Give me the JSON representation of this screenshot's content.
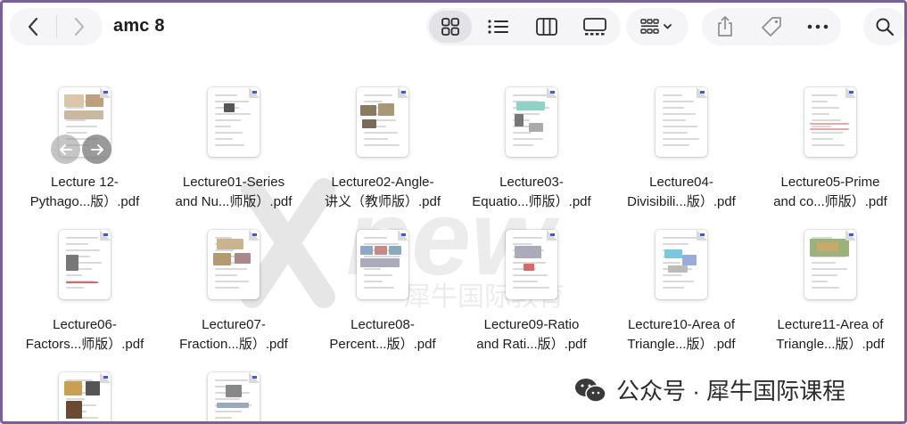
{
  "window": {
    "title": "amc 8"
  },
  "toolbar": {
    "back_icon": "chevron-left-icon",
    "forward_icon": "chevron-right-icon",
    "views": [
      "icon-view",
      "list-view",
      "column-view",
      "gallery-view"
    ],
    "active_view": "icon-view",
    "group_icon": "group-by-icon",
    "actions": [
      "share-icon",
      "tag-icon",
      "more-icon"
    ],
    "search_icon": "search-icon"
  },
  "files": [
    {
      "line1": "Lecture 12-",
      "line2": "Pythago...版）.pdf"
    },
    {
      "line1": "Lecture01-Series",
      "line2": "and Nu...师版）.pdf"
    },
    {
      "line1": "Lecture02-Angle-",
      "line2": "讲义（教师版）.pdf"
    },
    {
      "line1": "Lecture03-",
      "line2": "Equatio...师版）.pdf"
    },
    {
      "line1": "Lecture04-",
      "line2": "Divisibili...版）.pdf"
    },
    {
      "line1": "Lecture05-Prime",
      "line2": "and co...师版）.pdf"
    },
    {
      "line1": "Lecture06-",
      "line2": "Factors...师版）.pdf"
    },
    {
      "line1": "Lecture07-",
      "line2": "Fraction...版）.pdf"
    },
    {
      "line1": "Lecture08-",
      "line2": "Percent...版）.pdf"
    },
    {
      "line1": "Lecture09-Ratio",
      "line2": "and Rati...版）.pdf"
    },
    {
      "line1": "Lecture10-Area of",
      "line2": "Triangle...版）.pdf"
    },
    {
      "line1": "Lecture11-Area of",
      "line2": "Triangle...版）.pdf"
    },
    {
      "line1": "",
      "line2": ""
    },
    {
      "line1": "",
      "line2": ""
    }
  ],
  "watermark": {
    "brand": "new",
    "brand_cn": "犀牛国际教育",
    "account": "公众号 · 犀牛国际课程"
  },
  "colors": {
    "frame": "#7c5e9c",
    "toolbar_bg": "#f5f5f7",
    "active_view_bg": "#e3e3e7",
    "badge": "#3d5bd8"
  }
}
